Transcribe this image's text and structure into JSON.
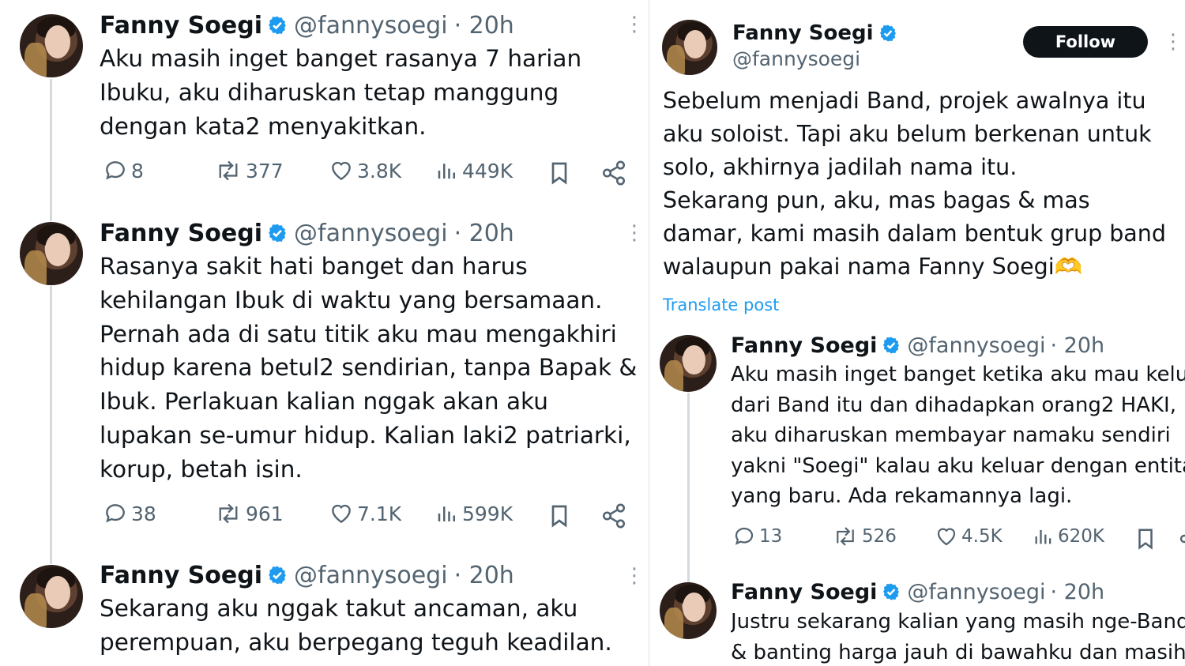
{
  "colors": {
    "accent": "#1d9bf0",
    "text": "#0f1419",
    "muted": "#536471",
    "follow_bg": "#0f1419"
  },
  "left_thread": [
    {
      "name": "Fanny Soegi",
      "handle": "@fannysoegi",
      "time": "· 20h",
      "text": "Aku masih inget banget rasanya 7 harian\nIbuku, aku diharuskan tetap manggung\ndengan kata2 menyakitkan.",
      "replies": "8",
      "reposts": "377",
      "likes": "3.8K",
      "views": "449K"
    },
    {
      "name": "Fanny Soegi",
      "handle": "@fannysoegi",
      "time": "· 20h",
      "text": "Rasanya sakit hati banget dan harus\nkehilangan Ibuk di waktu yang bersamaan.\nPernah ada di satu titik aku mau mengakhiri\nhidup karena betul2 sendirian, tanpa Bapak &\nIbuk. Perlakuan kalian nggak akan aku\nlupakan se-umur hidup. Kalian laki2 patriarki,\nkorup, betah isin.",
      "replies": "38",
      "reposts": "961",
      "likes": "7.1K",
      "views": "599K"
    },
    {
      "name": "Fanny Soegi",
      "handle": "@fannysoegi",
      "time": "· 20h",
      "text": "Sekarang aku nggak takut ancaman, aku\nperempuan, aku berpegang teguh keadilan."
    }
  ],
  "right_post": {
    "name": "Fanny Soegi",
    "handle": "@fannysoegi",
    "follow_label": "Follow",
    "text": "Sebelum menjadi Band, projek awalnya itu\naku soloist. Tapi aku belum berkenan untuk\nsolo, akhirnya jadilah nama itu.\nSekarang pun, aku, mas bagas & mas\ndamar, kami masih dalam bentuk grup band\nwalaupun pakai nama Fanny Soegi🫶",
    "translate_label": "Translate post"
  },
  "right_thread": [
    {
      "name": "Fanny Soegi",
      "handle": "@fannysoegi",
      "time": "· 20h",
      "text": "Aku masih inget banget ketika aku mau keluar\ndari Band itu dan dihadapkan orang2 HAKI,\naku diharuskan membayar namaku sendiri\nyakni \"Soegi\" kalau aku keluar dengan entitas\nyang baru. Ada rekamannya lagi.",
      "replies": "13",
      "reposts": "526",
      "likes": "4.5K",
      "views": "620K"
    },
    {
      "name": "Fanny Soegi",
      "handle": "@fannysoegi",
      "time": "· 20h",
      "text": "Justru sekarang kalian yang masih nge-Band\n& banting harga jauh di bawahku dan masih"
    }
  ],
  "icons": {
    "verified": "verified-badge-icon",
    "more": "more-icon",
    "reply": "reply-icon",
    "repost": "repost-icon",
    "like": "heart-icon",
    "views": "views-icon",
    "bookmark": "bookmark-icon",
    "share": "share-icon"
  }
}
